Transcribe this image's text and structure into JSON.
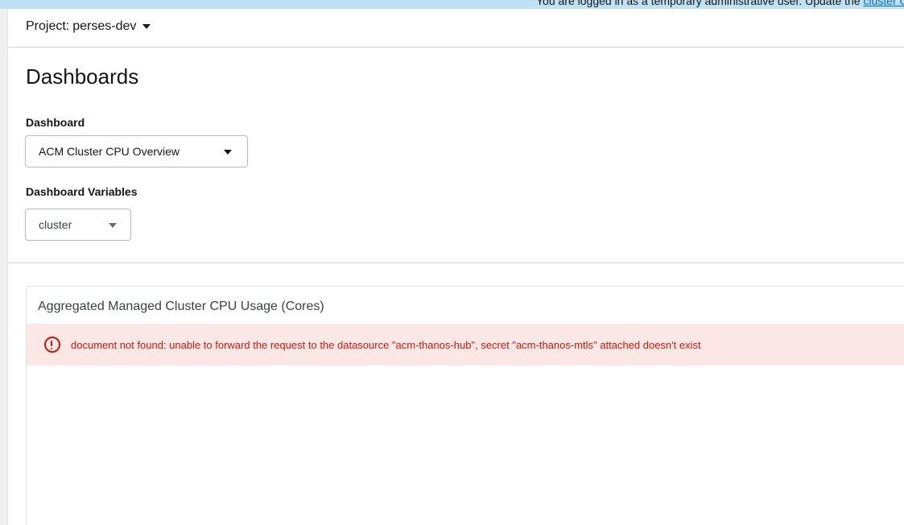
{
  "banner": {
    "text": "You are logged in as a temporary administrative user. Update the ",
    "link": "cluster OAuth configuration"
  },
  "project": {
    "prefix": "Project:",
    "name": "perses-dev"
  },
  "page": {
    "title": "Dashboards"
  },
  "dashboard": {
    "label": "Dashboard",
    "selected": "ACM Cluster CPU Overview"
  },
  "variables": {
    "label": "Dashboard Variables",
    "selected": "cluster"
  },
  "panel": {
    "title": "Aggregated Managed Cluster CPU Usage (Cores)",
    "error": "document not found: unable to forward the request to the datasource \"acm-thanos-hub\", secret \"acm-thanos-mtls\" attached doesn't exist"
  },
  "icons": {
    "project_caret": "caret-down-icon",
    "dashboard_caret": "caret-down-icon",
    "variable_caret": "caret-down-icon",
    "alert": "exclamation-circle-icon"
  },
  "colors": {
    "banner_bg": "#bee1f4",
    "alert_bg": "#fbe7e6",
    "alert_text": "#c9190b",
    "link": "#0066cc"
  }
}
